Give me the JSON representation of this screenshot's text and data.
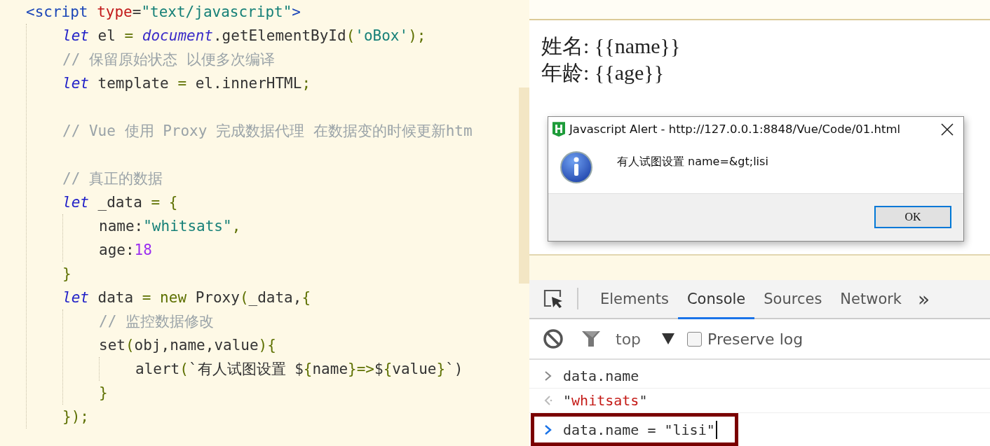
{
  "editor": {
    "lines": [
      {
        "kind": "code",
        "tokens": [
          {
            "text": "<script",
            "kind": "tag"
          },
          {
            "text": " type",
            "kind": "attr"
          },
          {
            "text": "=",
            "kind": "plain"
          },
          {
            "text": "\"text/javascript\"",
            "kind": "string"
          },
          {
            "text": ">",
            "kind": "tag"
          }
        ],
        "children": [
          {
            "kind": "code",
            "tokens": [
              {
                "text": "let",
                "kind": "keyword"
              },
              {
                "text": " el ",
                "kind": "plain"
              },
              {
                "text": "=",
                "kind": "punct"
              },
              {
                "text": " document",
                "kind": "object"
              },
              {
                "text": ".getElementById",
                "kind": "plain"
              },
              {
                "text": "(",
                "kind": "punct"
              },
              {
                "text": "'oBox'",
                "kind": "string"
              },
              {
                "text": ");",
                "kind": "punct"
              }
            ]
          },
          {
            "kind": "code",
            "tokens": [
              {
                "text": "// 保留原始状态 以便多次编译",
                "kind": "comment"
              }
            ]
          },
          {
            "kind": "code",
            "tokens": [
              {
                "text": "let",
                "kind": "keyword"
              },
              {
                "text": " template ",
                "kind": "plain"
              },
              {
                "text": "=",
                "kind": "punct"
              },
              {
                "text": " el.innerHTML",
                "kind": "plain"
              },
              {
                "text": ";",
                "kind": "punct"
              }
            ]
          },
          {
            "kind": "blank"
          },
          {
            "kind": "code",
            "tokens": [
              {
                "text": "// Vue 使用 Proxy 完成数据代理 在数据变的时候更新htm",
                "kind": "comment"
              }
            ]
          },
          {
            "kind": "blank"
          },
          {
            "kind": "code",
            "tokens": [
              {
                "text": "// 真正的数据",
                "kind": "comment"
              }
            ]
          },
          {
            "kind": "code",
            "tokens": [
              {
                "text": "let",
                "kind": "keyword"
              },
              {
                "text": " _data ",
                "kind": "plain"
              },
              {
                "text": "= {",
                "kind": "punct"
              }
            ],
            "children": [
              {
                "kind": "code",
                "tokens": [
                  {
                    "text": "name:",
                    "kind": "plain"
                  },
                  {
                    "text": "\"whitsats\"",
                    "kind": "string"
                  },
                  {
                    "text": ",",
                    "kind": "punct"
                  }
                ]
              },
              {
                "kind": "code",
                "tokens": [
                  {
                    "text": "age:",
                    "kind": "plain"
                  },
                  {
                    "text": "18",
                    "kind": "number"
                  }
                ]
              }
            ]
          },
          {
            "kind": "code",
            "tokens": [
              {
                "text": "}",
                "kind": "punct"
              }
            ]
          },
          {
            "kind": "code",
            "tokens": [
              {
                "text": "let",
                "kind": "keyword"
              },
              {
                "text": " data ",
                "kind": "plain"
              },
              {
                "text": "=",
                "kind": "punct"
              },
              {
                "text": " new",
                "kind": "punct"
              },
              {
                "text": " Proxy",
                "kind": "plain"
              },
              {
                "text": "(",
                "kind": "punct"
              },
              {
                "text": "_data,",
                "kind": "plain"
              },
              {
                "text": "{",
                "kind": "punct"
              }
            ],
            "children": [
              {
                "kind": "code",
                "tokens": [
                  {
                    "text": "// 监控数据修改",
                    "kind": "comment"
                  }
                ]
              },
              {
                "kind": "code",
                "tokens": [
                  {
                    "text": "set",
                    "kind": "plain"
                  },
                  {
                    "text": "(",
                    "kind": "punct"
                  },
                  {
                    "text": "obj,name,value",
                    "kind": "plain"
                  },
                  {
                    "text": "){",
                    "kind": "punct"
                  }
                ],
                "children": [
                  {
                    "kind": "code",
                    "tokens": [
                      {
                        "text": "alert",
                        "kind": "plain"
                      },
                      {
                        "text": "(",
                        "kind": "punct"
                      },
                      {
                        "text": "`有人试图设置 $",
                        "kind": "plain"
                      },
                      {
                        "text": "{",
                        "kind": "punct"
                      },
                      {
                        "text": "name",
                        "kind": "plain"
                      },
                      {
                        "text": "}=>",
                        "kind": "punct"
                      },
                      {
                        "text": "$",
                        "kind": "plain"
                      },
                      {
                        "text": "{",
                        "kind": "punct"
                      },
                      {
                        "text": "value",
                        "kind": "plain"
                      },
                      {
                        "text": "}",
                        "kind": "punct"
                      },
                      {
                        "text": "`)",
                        "kind": "plain"
                      }
                    ]
                  }
                ]
              },
              {
                "kind": "code",
                "tokens": [
                  {
                    "text": "}",
                    "kind": "punct"
                  }
                ]
              }
            ]
          },
          {
            "kind": "code",
            "tokens": [
              {
                "text": "});",
                "kind": "punct"
              }
            ]
          }
        ]
      }
    ]
  },
  "page": {
    "lines": [
      "姓名: {{name}}",
      "年龄: {{age}}"
    ]
  },
  "alert": {
    "app_icon_letter": "H",
    "title": "Javascript Alert - http://127.0.0.1:8848/Vue/Code/01.html",
    "message": "有人试图设置 name=&gt;lisi",
    "button": "OK"
  },
  "devtools": {
    "tabs": [
      {
        "label": "Elements",
        "selected": false
      },
      {
        "label": "Console",
        "selected": true
      },
      {
        "label": "Sources",
        "selected": false
      },
      {
        "label": "Network",
        "selected": false
      }
    ],
    "more": "»",
    "context": "top",
    "preserve_log": {
      "label": "Preserve log",
      "checked": false
    },
    "entries": [
      {
        "kind": "input",
        "highlighted": false,
        "tokens": [
          {
            "text": "data.name",
            "kind": "plain"
          }
        ]
      },
      {
        "kind": "output",
        "highlighted": false,
        "tokens": [
          {
            "text": "\"",
            "kind": "plain"
          },
          {
            "text": "whitsats",
            "kind": "red"
          },
          {
            "text": "\"",
            "kind": "plain"
          }
        ]
      },
      {
        "kind": "prompt",
        "highlighted": true,
        "tokens": [
          {
            "text": "data.name = \"lisi\"",
            "kind": "plain"
          }
        ]
      }
    ]
  }
}
